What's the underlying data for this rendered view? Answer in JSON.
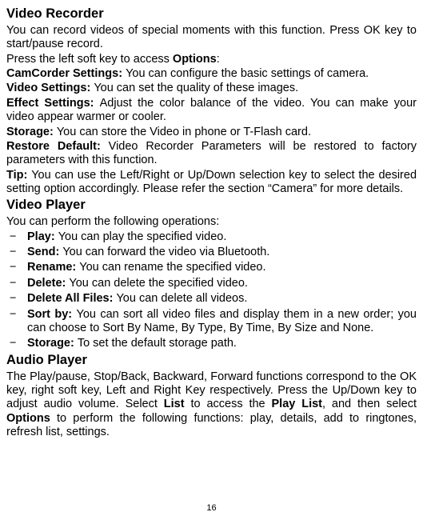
{
  "vr": {
    "heading": "Video Recorder",
    "intro": "You can record videos of special moments with this function. Press OK key to start/pause record.",
    "press_left_a": "Press the left soft key to access ",
    "press_left_b": "Options",
    "press_left_c": ":",
    "camcorder_lbl": "CamCorder Settings: ",
    "camcorder_txt": "You can configure the basic settings of camera.",
    "video_settings_lbl": "Video Settings: ",
    "video_settings_txt": "You can set the quality of these images.",
    "effect_lbl": "Effect Settings: ",
    "effect_txt": "Adjust the color balance of the video. You can make your video appear warmer or cooler.",
    "storage_lbl": "Storage: ",
    "storage_txt": "You can store the Video in phone or T-Flash card.",
    "restore_lbl": "Restore Default: ",
    "restore_txt": "Video Recorder Parameters will be restored to factory parameters with this function.",
    "tip_lbl": "Tip: ",
    "tip_txt": "You can use the Left/Right or Up/Down selection key to select the desired setting option accordingly. Please refer the section “Camera” for more details."
  },
  "vp": {
    "heading": "Video Player",
    "intro": "You can perform the following operations:",
    "items": [
      {
        "lbl": "Play: ",
        "txt": "You can play the specified video."
      },
      {
        "lbl": "Send: ",
        "txt": "You can forward the video via Bluetooth."
      },
      {
        "lbl": "Rename: ",
        "txt": "You can rename the specified video."
      },
      {
        "lbl": "Delete: ",
        "txt": "You can delete the specified video."
      },
      {
        "lbl": "Delete All Files: ",
        "txt": "You can delete all videos."
      },
      {
        "lbl": "Sort by: ",
        "txt": "You can sort all video files and display them in a new order; you can choose to Sort By Name, By Type, By Time, By Size and None."
      },
      {
        "lbl": "Storage: ",
        "txt": "To set the default storage path."
      }
    ]
  },
  "ap": {
    "heading": "Audio Player",
    "t1": "The Play/pause, Stop/Back, Backward, Forward functions correspond to the OK key, right soft key, Left and Right Key respectively. Press the Up/Down key to adjust audio volume. Select ",
    "t2": "List",
    "t3": " to access the ",
    "t4": "Play List",
    "t5": ", and then select ",
    "t6": "Options",
    "t7": " to perform the following functions: play, details, add to ringtones, refresh list, settings."
  },
  "page_number": "16"
}
